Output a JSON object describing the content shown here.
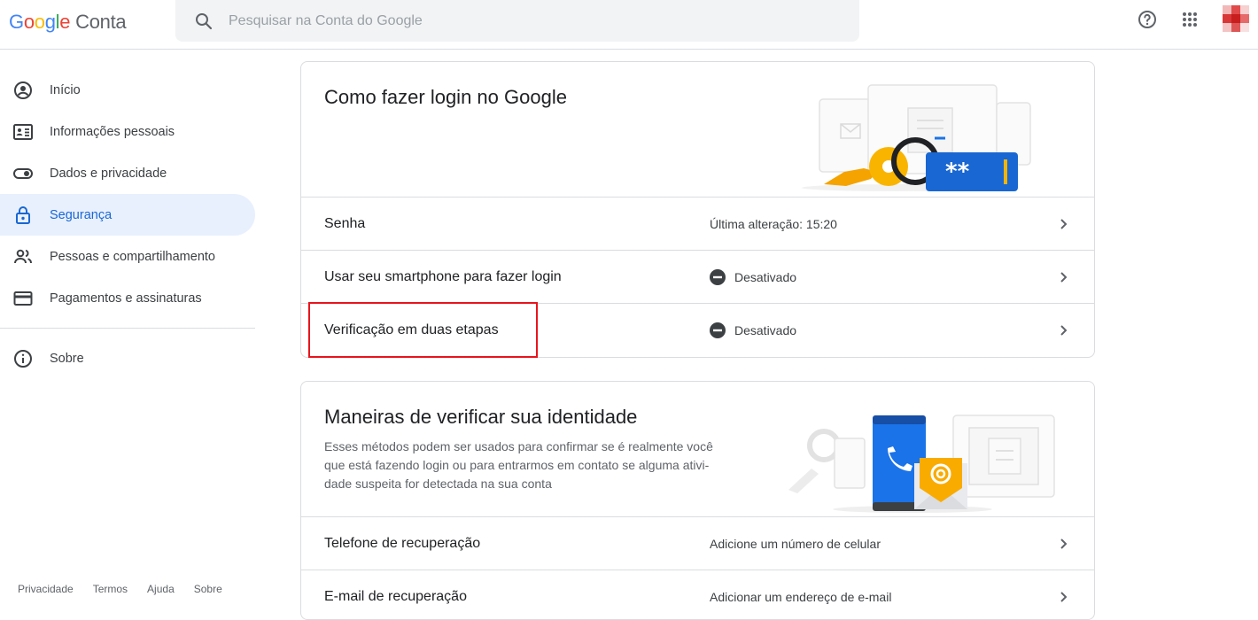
{
  "header": {
    "logo_letters": [
      "G",
      "o",
      "o",
      "g",
      "l",
      "e"
    ],
    "product": "Conta",
    "search_placeholder": "Pesquisar na Conta do Google",
    "help_icon": "help-circle-icon",
    "apps_icon": "apps-grid-icon"
  },
  "sidebar": {
    "items": [
      {
        "label": "Início",
        "icon": "account-circle-icon"
      },
      {
        "label": "Informações pessoais",
        "icon": "id-card-icon"
      },
      {
        "label": "Dados e privacidade",
        "icon": "toggle-icon"
      },
      {
        "label": "Segurança",
        "icon": "lock-icon",
        "active": true
      },
      {
        "label": "Pessoas e compartilhamento",
        "icon": "people-icon"
      },
      {
        "label": "Pagamentos e assinaturas",
        "icon": "credit-card-icon"
      }
    ],
    "about": {
      "label": "Sobre",
      "icon": "info-icon"
    },
    "footer": [
      "Privacidade",
      "Termos",
      "Ajuda",
      "Sobre"
    ]
  },
  "signin_card": {
    "title": "Como fazer login no Google",
    "rows": [
      {
        "label": "Senha",
        "value": "Última alteração: 15:20"
      },
      {
        "label": "Usar seu smartphone para fazer login",
        "value": "Desativado"
      },
      {
        "label": "Verificação em duas etapas",
        "value": "Desativado"
      }
    ],
    "password_mask": "**"
  },
  "verify_card": {
    "title": "Maneiras de verificar sua identidade",
    "description_lines": [
      "Esses métodos podem ser usados para confirmar se é realmente você",
      "que está fazendo login ou para entrarmos em contato se alguma ativi-",
      "dade suspeita for detectada na sua conta"
    ],
    "rows": [
      {
        "label": "Telefone de recuperação",
        "value": "Adicione um número de celular"
      },
      {
        "label": "E-mail de recuperação",
        "value": "Adicionar um endereço de e-mail"
      }
    ]
  },
  "colors": {
    "accent": "#1a73e8",
    "active_bg": "#e8f0fe",
    "highlight": "#e8141c"
  }
}
